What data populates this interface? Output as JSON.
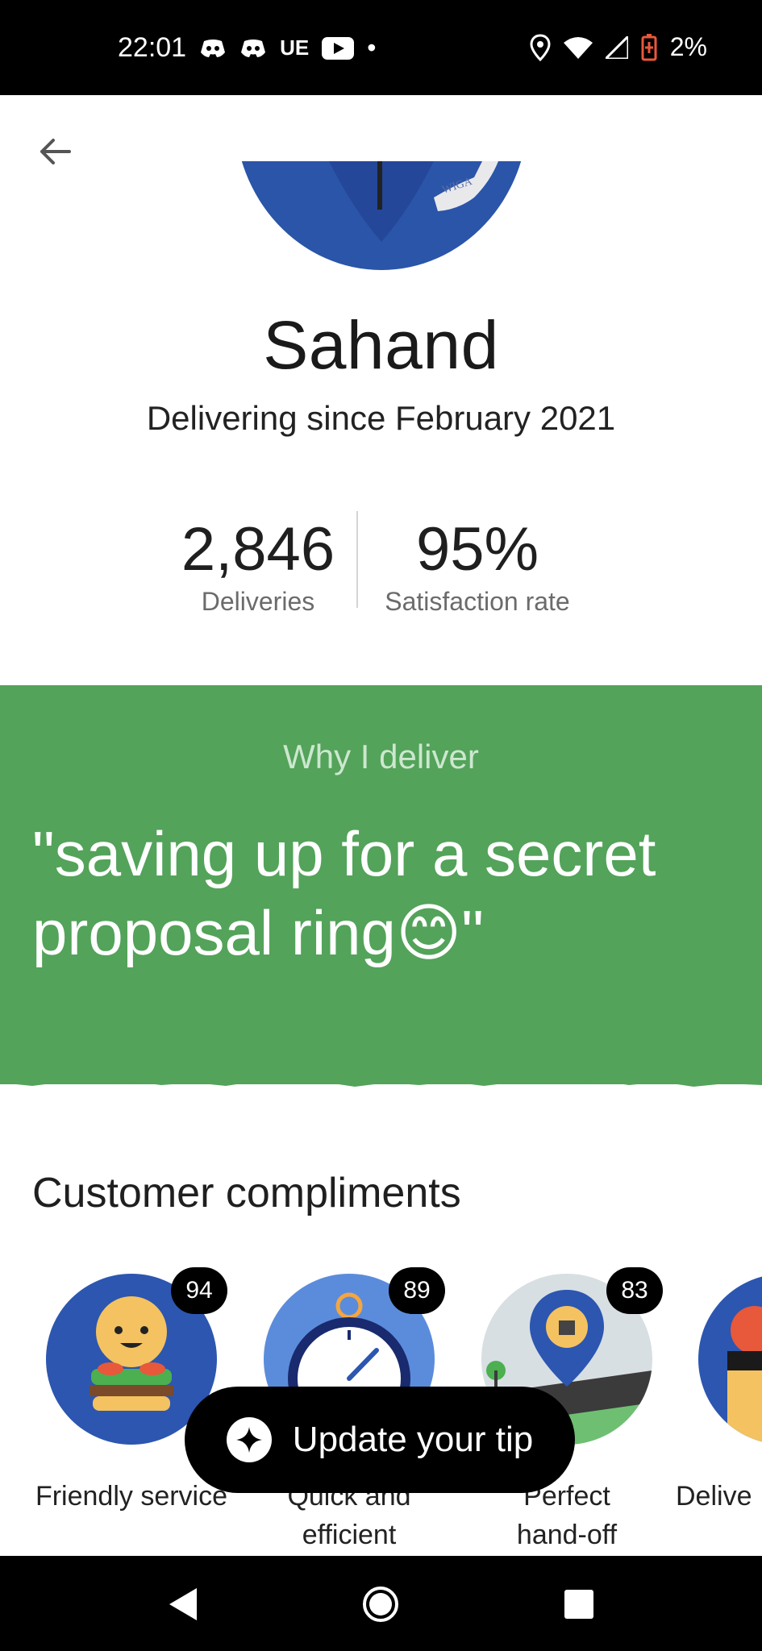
{
  "status_bar": {
    "time": "22:01",
    "carrier_text": "UE",
    "dot": "•",
    "battery": "2%",
    "icons": [
      "discord-icon",
      "discord-icon",
      "youtube-icon",
      "location-icon",
      "wifi-icon",
      "signal-icon",
      "battery-charging-icon"
    ]
  },
  "header": {
    "back_icon": "back-arrow-icon"
  },
  "profile": {
    "name": "Sahand",
    "since": "Delivering since February 2021",
    "deliveries_value": "2,846",
    "deliveries_label": "Deliveries",
    "satisfaction_value": "95%",
    "satisfaction_label": "Satisfaction rate",
    "avatar_text": "WIGA"
  },
  "why": {
    "title": "Why I deliver",
    "quote": "\"saving up for a secret proposal ring😊\""
  },
  "compliments": {
    "title": "Customer compliments",
    "items": [
      {
        "label": "Friendly service",
        "count": "94"
      },
      {
        "label": "Quick and efficient",
        "count": "89"
      },
      {
        "label": "Perfect hand-off",
        "count": "83"
      },
      {
        "label": "Delive",
        "count": ""
      }
    ]
  },
  "tip_button": {
    "label": "Update your tip"
  },
  "colors": {
    "accent_green": "#53a35a",
    "black": "#000000"
  }
}
